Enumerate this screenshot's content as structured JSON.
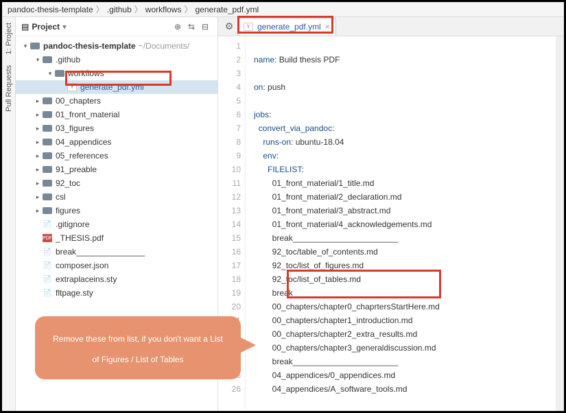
{
  "breadcrumbs": [
    "pandoc-thesis-template",
    ".github",
    "workflows",
    "generate_pdf.yml"
  ],
  "projectHeader": {
    "label": "Project"
  },
  "leftRail": {
    "tab1": "1: Project",
    "tab2": "Pull Requests"
  },
  "tree": [
    {
      "depth": 0,
      "arrow": "v",
      "icon": "folder",
      "name": "pandoc-thesis-template",
      "path": "~/Documents/",
      "bold": true
    },
    {
      "depth": 1,
      "arrow": "v",
      "icon": "folder",
      "name": ".github"
    },
    {
      "depth": 2,
      "arrow": "v",
      "icon": "folder",
      "name": "workflows"
    },
    {
      "depth": 3,
      "arrow": "",
      "icon": "yml",
      "name": "generate_pdf.yml",
      "selected": true,
      "link": true
    },
    {
      "depth": 1,
      "arrow": ">",
      "icon": "folder",
      "name": "00_chapters"
    },
    {
      "depth": 1,
      "arrow": ">",
      "icon": "folder",
      "name": "01_front_material"
    },
    {
      "depth": 1,
      "arrow": ">",
      "icon": "folder",
      "name": "03_figures"
    },
    {
      "depth": 1,
      "arrow": ">",
      "icon": "folder",
      "name": "04_appendices"
    },
    {
      "depth": 1,
      "arrow": ">",
      "icon": "folder",
      "name": "05_references"
    },
    {
      "depth": 1,
      "arrow": ">",
      "icon": "folder",
      "name": "91_preable"
    },
    {
      "depth": 1,
      "arrow": ">",
      "icon": "folder",
      "name": "92_toc"
    },
    {
      "depth": 1,
      "arrow": ">",
      "icon": "folder",
      "name": "csl"
    },
    {
      "depth": 1,
      "arrow": ">",
      "icon": "folder",
      "name": "figures"
    },
    {
      "depth": 1,
      "arrow": "",
      "icon": "file",
      "name": ".gitignore"
    },
    {
      "depth": 1,
      "arrow": "",
      "icon": "pdf",
      "name": "_THESIS.pdf"
    },
    {
      "depth": 1,
      "arrow": "",
      "icon": "file",
      "name": "break_______________"
    },
    {
      "depth": 1,
      "arrow": "",
      "icon": "file",
      "name": "composer.json"
    },
    {
      "depth": 1,
      "arrow": "",
      "icon": "file",
      "name": "extraplaceins.sty"
    },
    {
      "depth": 1,
      "arrow": "",
      "icon": "file",
      "name": "fltpage.sty"
    }
  ],
  "editorTab": {
    "name": "generate_pdf.yml"
  },
  "code": {
    "lines": [
      {
        "n": 1,
        "html": ""
      },
      {
        "n": 2,
        "html": "<span class='k-key'>name</span>: <span class='k-t'>Build thesis PDF</span>"
      },
      {
        "n": 3,
        "html": ""
      },
      {
        "n": 4,
        "html": "<span class='k-key'>on</span>: <span class='k-t'>push</span>"
      },
      {
        "n": 5,
        "html": ""
      },
      {
        "n": 6,
        "html": "<span class='k-key'>jobs</span>:"
      },
      {
        "n": 7,
        "html": "  <span class='k-key'>convert_via_pandoc</span>:"
      },
      {
        "n": 8,
        "html": "    <span class='k-key'>runs-on</span>: <span class='k-t'>ubuntu-18.04</span>"
      },
      {
        "n": 9,
        "html": "    <span class='k-key'>env</span>:"
      },
      {
        "n": 10,
        "html": "      <span class='k-key'>FILELIST</span>:"
      },
      {
        "n": 11,
        "html": "        <span class='k-t'>01_front_material/1_title.md</span>"
      },
      {
        "n": 12,
        "html": "        <span class='k-t'>01_front_material/2_declaration.md</span>"
      },
      {
        "n": 13,
        "html": "        <span class='k-t'>01_front_material/3_abstract.md</span>"
      },
      {
        "n": 14,
        "html": "        <span class='k-t'>01_front_material/4_acknowledgements.md</span>"
      },
      {
        "n": 15,
        "html": "        <span class='k-t'>break_______________________</span>"
      },
      {
        "n": 16,
        "html": "        <span class='k-t'>92_toc/table_of_contents.md</span>"
      },
      {
        "n": 17,
        "html": "        <span class='k-t'>92_toc/list_of_figures.md</span>"
      },
      {
        "n": 18,
        "html": "        <span class='k-t'>92_toc/list_of_tables.md</span>"
      },
      {
        "n": 19,
        "html": "        <span class='k-t'>break_______________________</span>"
      },
      {
        "n": 20,
        "html": "        <span class='k-t'>00_chapters/chapter0_chaprtersStartHere.md</span>"
      },
      {
        "n": 21,
        "html": "        <span class='k-t'>00_chapters/chapter1_introduction.md</span>"
      },
      {
        "n": 22,
        "html": "        <span class='k-t'>00_chapters/chapter2_extra_results.md</span>"
      },
      {
        "n": 23,
        "html": "        <span class='k-t'>00_chapters/chapter3_generaldiscussion.md</span>"
      },
      {
        "n": 24,
        "html": "        <span class='k-t'>break_______________________</span>"
      },
      {
        "n": 25,
        "html": "        <span class='k-t'>04_appendices/0_appendices.md</span>"
      },
      {
        "n": 26,
        "html": "        <span class='k-t'>04_appendices/A_software_tools.md</span>"
      }
    ]
  },
  "callout": "Remove these from list, if you don't want a List of Figures / List of Tables"
}
